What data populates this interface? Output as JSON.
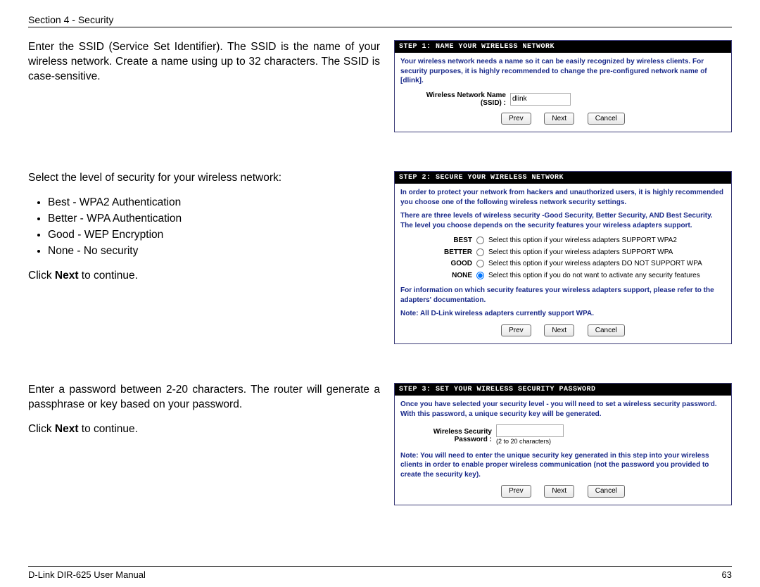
{
  "header": "Section 4 - Security",
  "footer": {
    "left": "D-Link DIR-625 User Manual",
    "right": "63"
  },
  "step1": {
    "intro": "Enter the SSID (Service Set Identifier). The SSID is the name of your wireless network. Create a name using up to 32 characters. The SSID is case-sensitive.",
    "title": "Step 1: Name Your Wireless Network",
    "desc": "Your wireless network needs a name so it can be easily recognized by wireless clients. For security purposes, it is highly recommended to change the pre-configured network name of [dlink].",
    "label_line1": "Wireless Network Name",
    "label_line2": "(SSID) :",
    "value": "dlink",
    "btn_prev": "Prev",
    "btn_next": "Next",
    "btn_cancel": "Cancel"
  },
  "step2": {
    "intro": "Select the level of security for your wireless network:",
    "bullets": [
      "Best - WPA2 Authentication",
      "Better - WPA Authentication",
      "Good - WEP Encryption",
      "None - No security"
    ],
    "click_pre": "Click ",
    "click_bold": "Next",
    "click_post": " to continue.",
    "title": "Step 2: Secure Your Wireless Network",
    "desc1": "In order to protect your network from hackers and unauthorized users, it is highly recommended you choose one of the following wireless network security settings.",
    "desc2": "There are three levels of wireless security -Good Security, Better Security, AND Best Security. The level you choose depends on the security features your wireless adapters support.",
    "options": [
      {
        "label": "BEST",
        "desc": "Select this option if your wireless adapters SUPPORT WPA2",
        "selected": false
      },
      {
        "label": "BETTER",
        "desc": "Select this option if your wireless adapters SUPPORT WPA",
        "selected": false
      },
      {
        "label": "GOOD",
        "desc": "Select this option if your wireless adapters DO NOT SUPPORT WPA",
        "selected": false
      },
      {
        "label": "NONE",
        "desc": "Select this option if you do not want to activate any security features",
        "selected": true
      }
    ],
    "footnote1": "For information on which security features your wireless adapters support, please refer to the adapters' documentation.",
    "footnote2": "Note: All D-Link wireless adapters currently support WPA.",
    "btn_prev": "Prev",
    "btn_next": "Next",
    "btn_cancel": "Cancel"
  },
  "step3": {
    "intro": "Enter a password between 2-20 characters. The router will generate a passphrase or key based on your password.",
    "click_pre": "Click ",
    "click_bold": "Next",
    "click_post": " to continue.",
    "title": "Step 3: Set Your Wireless Security Password",
    "desc": "Once you have selected your security level - you will need to set a wireless security password. With this password, a unique security key will be generated.",
    "label": "Wireless Security Password :",
    "hint": "(2 to 20 characters)",
    "footnote": "Note: You will need to enter the unique security key generated in this step into your wireless clients in order to enable proper wireless communication (not the password you provided to create the security key).",
    "btn_prev": "Prev",
    "btn_next": "Next",
    "btn_cancel": "Cancel"
  }
}
